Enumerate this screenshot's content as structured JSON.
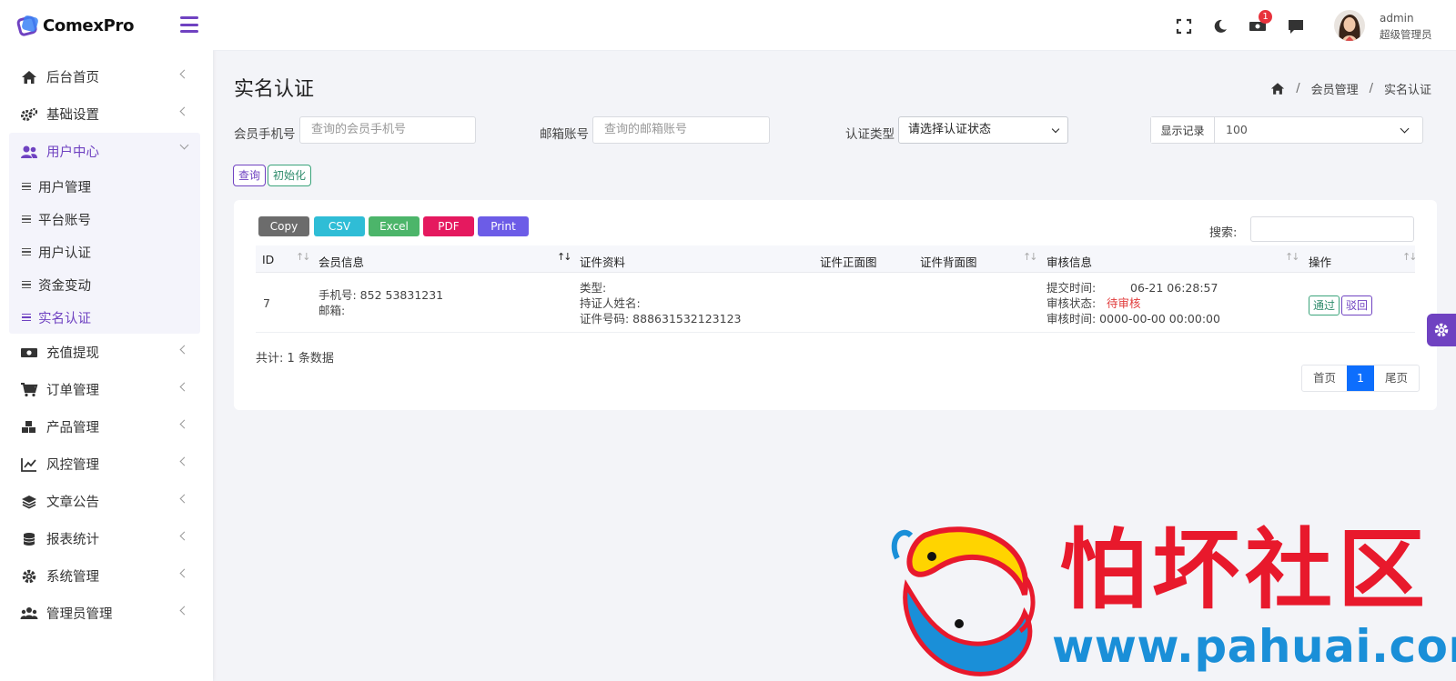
{
  "brand": {
    "name": "ComexPro"
  },
  "sidebar": {
    "items": [
      {
        "label": "后台首页",
        "icon": "home-icon"
      },
      {
        "label": "基础设置",
        "icon": "gears-icon"
      },
      {
        "label": "用户中心",
        "icon": "users-icon",
        "expanded": true
      },
      {
        "label": "充值提现",
        "icon": "money-icon"
      },
      {
        "label": "订单管理",
        "icon": "cart-icon"
      },
      {
        "label": "产品管理",
        "icon": "cubes-icon"
      },
      {
        "label": "风控管理",
        "icon": "chart-line-icon"
      },
      {
        "label": "文章公告",
        "icon": "layers-icon"
      },
      {
        "label": "报表统计",
        "icon": "coins-icon"
      },
      {
        "label": "系统管理",
        "icon": "gear-icon"
      },
      {
        "label": "管理员管理",
        "icon": "user-group-icon"
      }
    ],
    "sub_items": [
      {
        "label": "用户管理"
      },
      {
        "label": "平台账号"
      },
      {
        "label": "用户认证"
      },
      {
        "label": "资金变动"
      },
      {
        "label": "实名认证",
        "active": true
      }
    ]
  },
  "topbar": {
    "notification_count": "1",
    "user_name": "admin",
    "user_role": "超级管理员"
  },
  "page": {
    "title": "实名认证",
    "breadcrumb": [
      "会员管理",
      "实名认证"
    ]
  },
  "filters": {
    "phone_label": "会员手机号",
    "phone_placeholder": "查询的会员手机号",
    "email_label": "邮箱账号",
    "email_placeholder": "查询的邮箱账号",
    "type_label": "认证类型",
    "type_value": "请选择认证状态",
    "show_label": "显示记录",
    "show_value": "100",
    "query_btn": "查询",
    "reset_btn": "初始化"
  },
  "export_buttons": [
    {
      "label": "Copy",
      "color": "#6c6c6c"
    },
    {
      "label": "CSV",
      "color": "#2fbdd6"
    },
    {
      "label": "Excel",
      "color": "#4cb56a"
    },
    {
      "label": "PDF",
      "color": "#e5195f"
    },
    {
      "label": "Print",
      "color": "#6c5ce7"
    }
  ],
  "table": {
    "search_label": "搜索:",
    "columns": [
      "ID",
      "会员信息",
      "证件资料",
      "证件正面图",
      "证件背面图",
      "审核信息",
      "操作"
    ],
    "rows": [
      {
        "id": "7",
        "phone": "手机号: 852 53831231",
        "email": "邮箱:",
        "doc_type": "类型:",
        "doc_holder": "持证人姓名:",
        "doc_number": "证件号码: 888631532123123",
        "submit_time_label": "提交时间:",
        "submit_time": "06-21 06:28:57",
        "status_label": "审核状态:",
        "status": "待审核",
        "review_time": "审核时间: 0000-00-00 00:00:00",
        "pass_btn": "通过",
        "reject_btn": "驳回"
      }
    ],
    "total": "共计: 1 条数据",
    "pager": {
      "first": "首页",
      "current": "1",
      "last": "尾页"
    }
  },
  "watermark": {
    "title": "怕坏社区",
    "url": "www.pahuai.com"
  },
  "colors": {
    "accent": "#6f42c1",
    "pending": "#e13b3b",
    "pager_active": "#0d6efd"
  }
}
